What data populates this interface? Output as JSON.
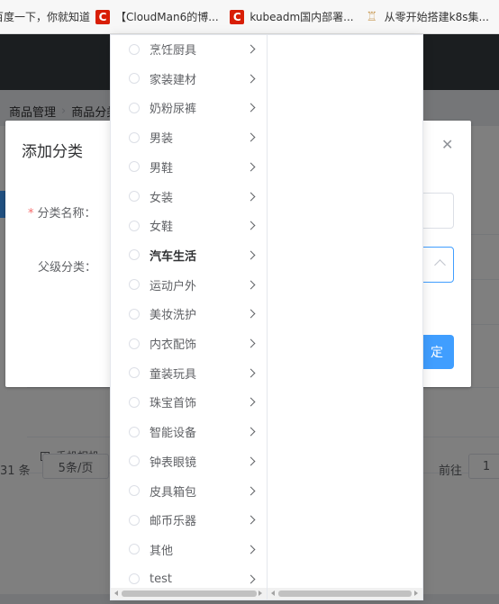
{
  "bookmarks": [
    {
      "label": "百度一下，你就知道",
      "icon": "none"
    },
    {
      "label": "【CloudMan6的博...",
      "icon": "C"
    },
    {
      "label": "kubeadm国内部署...",
      "icon": "C"
    },
    {
      "label": "从零开始搭建k8s集...",
      "icon": "logo"
    }
  ],
  "breadcrumb": [
    "商品管理",
    "商品分类"
  ],
  "page": {
    "tree_row_label": "手机相机",
    "pager_total": "31 条",
    "pager_size": "5条/页",
    "pager_goto": "前往",
    "pager_page": "1"
  },
  "dialog": {
    "title": "添加分类",
    "name_label": "分类名称：",
    "parent_label": "父级分类：",
    "confirm_label": "定",
    "close_icon": "close-icon"
  },
  "cascader": {
    "items": [
      {
        "label": "烹饪厨具",
        "active": false
      },
      {
        "label": "家装建材",
        "active": false
      },
      {
        "label": "奶粉尿裤",
        "active": false
      },
      {
        "label": "男装",
        "active": false
      },
      {
        "label": "男鞋",
        "active": false
      },
      {
        "label": "女装",
        "active": false
      },
      {
        "label": "女鞋",
        "active": false
      },
      {
        "label": "汽车生活",
        "active": true
      },
      {
        "label": "运动户外",
        "active": false
      },
      {
        "label": "美妆洗护",
        "active": false
      },
      {
        "label": "内衣配饰",
        "active": false
      },
      {
        "label": "童装玩具",
        "active": false
      },
      {
        "label": "珠宝首饰",
        "active": false
      },
      {
        "label": "智能设备",
        "active": false
      },
      {
        "label": "钟表眼镜",
        "active": false
      },
      {
        "label": "皮具箱包",
        "active": false
      },
      {
        "label": "邮币乐器",
        "active": false
      },
      {
        "label": "其他",
        "active": false
      },
      {
        "label": "test",
        "active": false
      }
    ]
  },
  "colors": {
    "primary": "#409eff",
    "header": "#373d41",
    "danger": "#f56c6c"
  }
}
